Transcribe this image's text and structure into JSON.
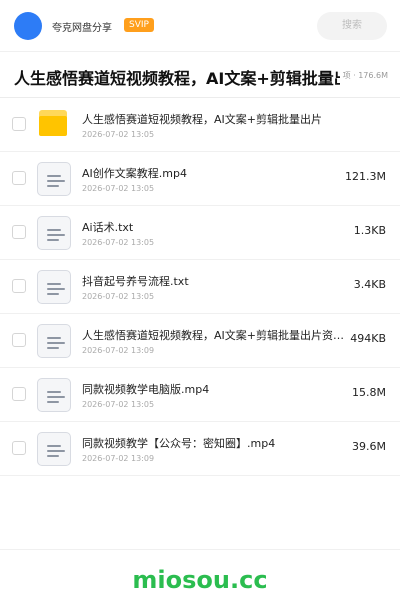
{
  "header": {
    "user_name": "夸克网盘分享",
    "svip_label": "SVIP",
    "search_placeholder": "搜索"
  },
  "share": {
    "title": "人生感悟赛道短视频教程，AI文案+剪辑批量出片",
    "meta": "项 · 176.6M"
  },
  "files": [
    {
      "name": "人生感悟赛道短视频教程，AI文案+剪辑批量出片",
      "date": "2026-07-02 13:05",
      "size": "",
      "icon": "folder-icon"
    },
    {
      "name": "AI创作文案教程.mp4",
      "date": "2026-07-02 13:05",
      "size": "121.3M",
      "icon": "file-icon"
    },
    {
      "name": "Ai话术.txt",
      "date": "2026-07-02 13:05",
      "size": "1.3KB",
      "icon": "file-icon"
    },
    {
      "name": "抖音起号养号流程.txt",
      "date": "2026-07-02 13:05",
      "size": "3.4KB",
      "icon": "file-icon"
    },
    {
      "name": "人生感悟赛道短视频教程，AI文案+剪辑批量出片资料…",
      "date": "2026-07-02 13:09",
      "size": "494KB",
      "icon": "file-icon"
    },
    {
      "name": "同款视频教学电脑版.mp4",
      "date": "2026-07-02 13:05",
      "size": "15.8M",
      "icon": "file-icon"
    },
    {
      "name": "同款视频教学【公众号：密知圈】.mp4",
      "date": "2026-07-02 13:09",
      "size": "39.6M",
      "icon": "file-icon"
    }
  ],
  "footer": {
    "brand": "miosou.cc"
  },
  "colors": {
    "avatar": "#2d7cf6",
    "svip": "#ff9f1c",
    "folder": "#ffc400",
    "brand": "#2bbd4f"
  }
}
